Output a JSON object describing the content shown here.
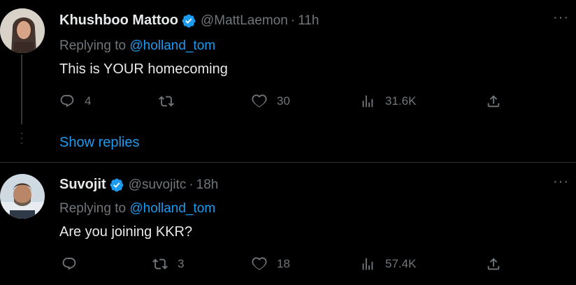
{
  "tweets": [
    {
      "name": "Khushboo Mattoo",
      "handle": "@MattLaemon",
      "sep": "·",
      "time": "11h",
      "replying_prefix": "Replying to ",
      "replying_to": "@holland_tom",
      "text": "This is YOUR homecoming",
      "replies": "4",
      "retweets": "",
      "likes": "30",
      "views": "31.6K"
    },
    {
      "name": "Suvojit",
      "handle": "@suvojitc",
      "sep": "·",
      "time": "18h",
      "replying_prefix": "Replying to ",
      "replying_to": "@holland_tom",
      "text": "Are you joining KKR?",
      "replies": "",
      "retweets": "3",
      "likes": "18",
      "views": "57.4K"
    }
  ],
  "show_replies_label": "Show replies",
  "colors": {
    "accent": "#1d9bf0",
    "muted": "#71767b",
    "text": "#e7e9ea",
    "background": "#000000"
  },
  "icons": [
    "verified-badge-icon",
    "more-icon",
    "reply-icon",
    "retweet-icon",
    "like-icon",
    "views-icon",
    "share-icon"
  ]
}
